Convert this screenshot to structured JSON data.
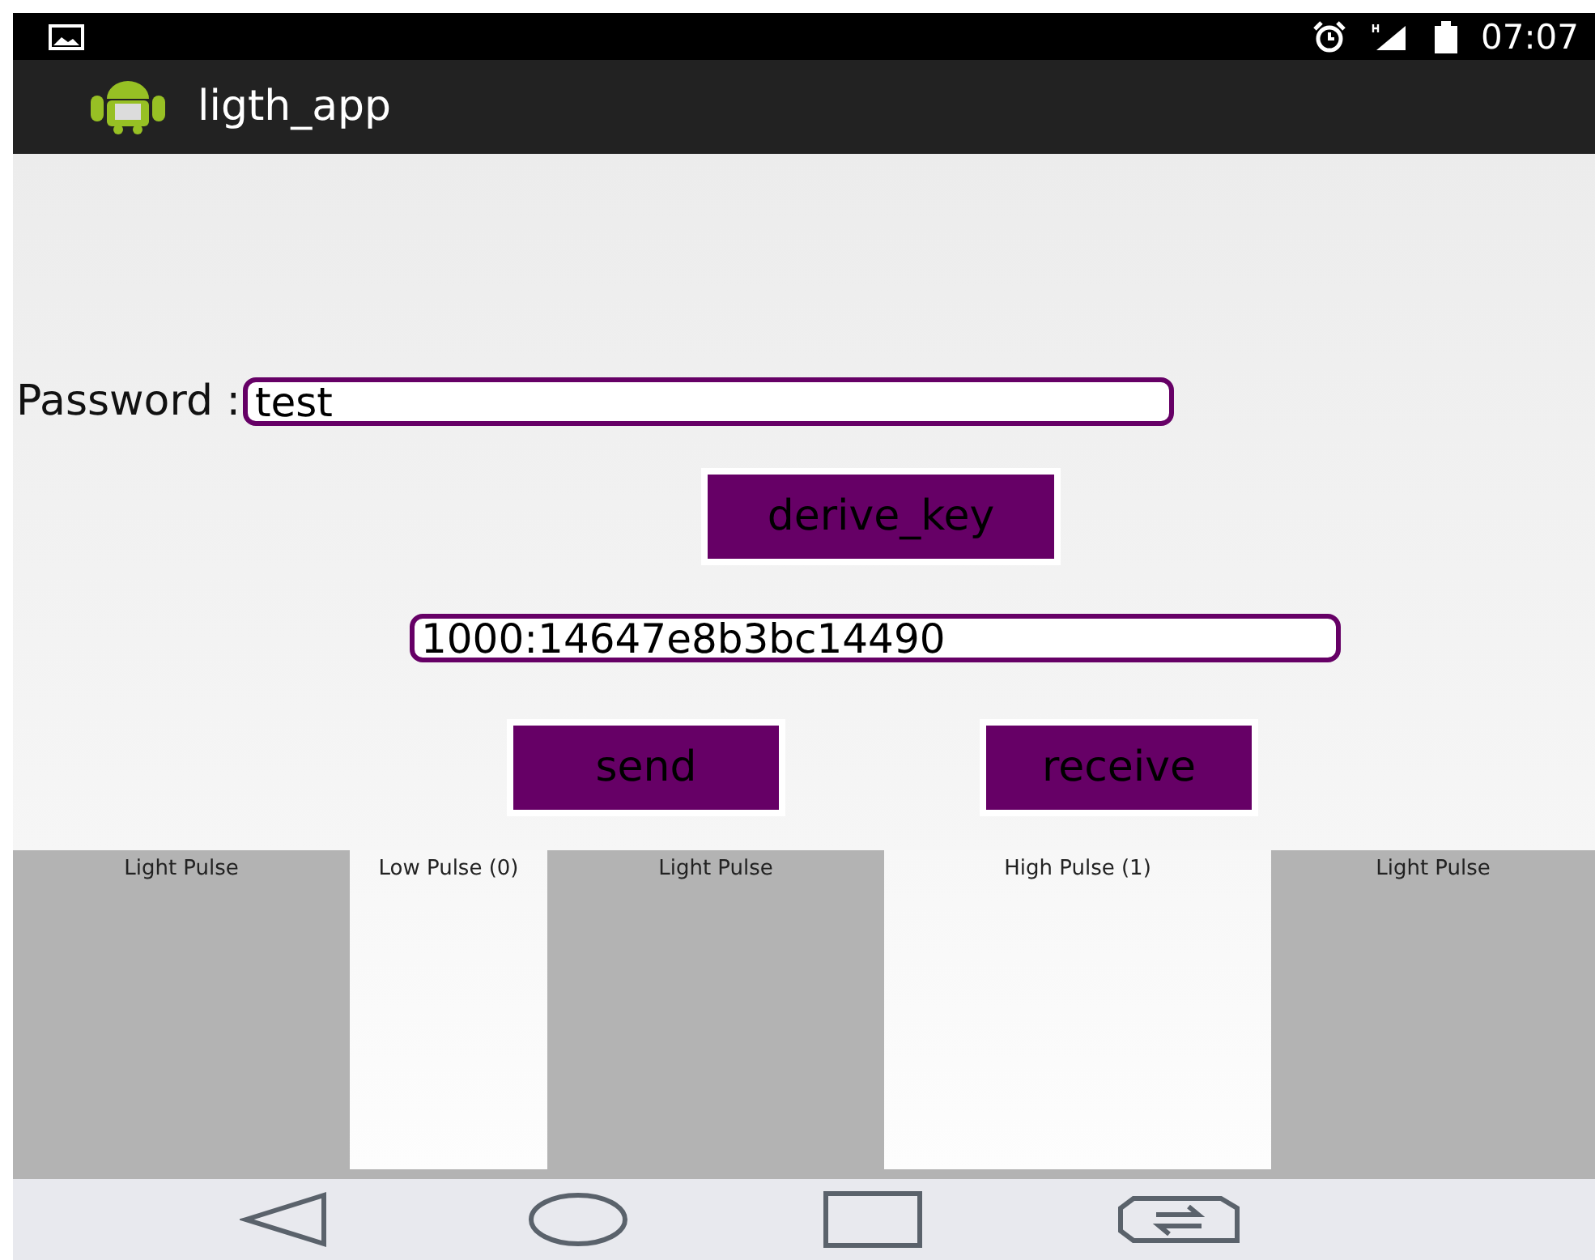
{
  "status_bar": {
    "time": "07:07"
  },
  "app_bar": {
    "title": "ligth_app"
  },
  "password": {
    "label": "Password :",
    "value": "test"
  },
  "derive_button": "derive_key",
  "key_field": {
    "value": "1000:14647e8b3bc14490"
  },
  "buttons": [
    "send",
    "receive"
  ],
  "pulses": [
    {
      "kind": "light",
      "label": "Light Pulse"
    },
    {
      "kind": "low",
      "label": "Low Pulse (0)"
    },
    {
      "kind": "light",
      "label": "Light Pulse"
    },
    {
      "kind": "high",
      "label": "High Pulse (1)"
    },
    {
      "kind": "light",
      "label": "Light Pulse"
    }
  ]
}
